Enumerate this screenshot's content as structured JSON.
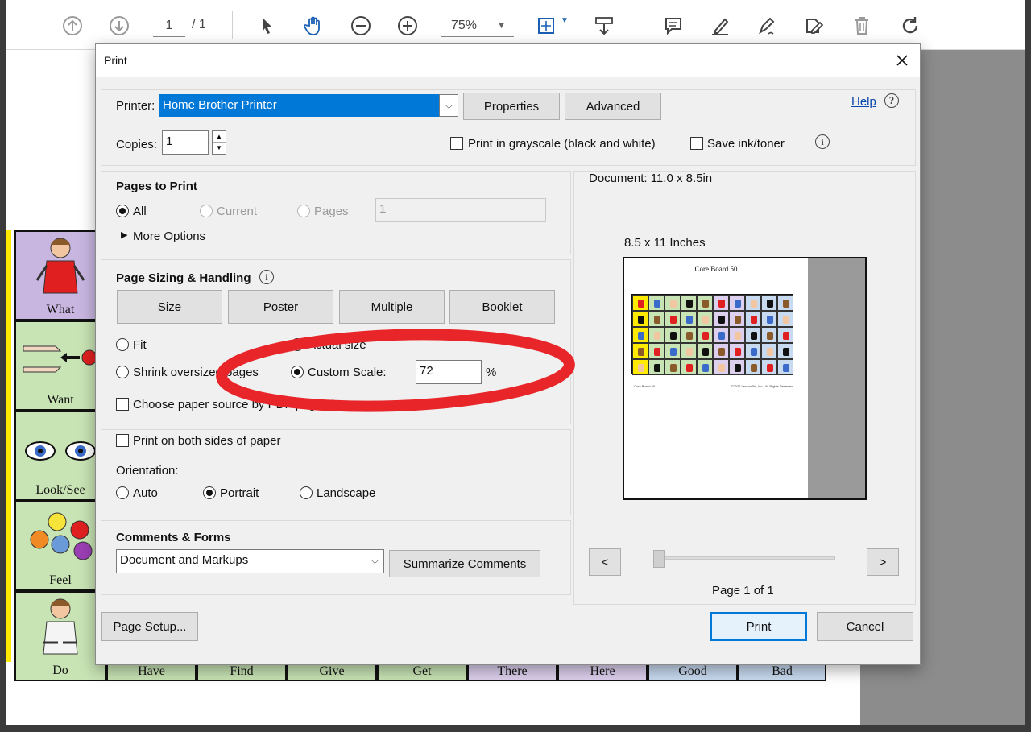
{
  "toolbar": {
    "page_current": "1",
    "page_total": "/ 1",
    "zoom": "75%"
  },
  "board": {
    "left_labels": [
      "What",
      "Want",
      "Look/See",
      "Feel",
      "Do"
    ],
    "bottom_labels": [
      "Have",
      "Find",
      "Give",
      "Get",
      "There",
      "Here",
      "Good",
      "Bad"
    ],
    "colors": {
      "what": "#c8b6e0",
      "green": "#c8e3b4",
      "purple": "#ddd0ee",
      "blue": "#c8daf0",
      "stripe": "#ffea00"
    }
  },
  "dialog": {
    "title": "Print",
    "printer_label": "Printer:",
    "printer_value": "Home Brother Printer",
    "properties_button": "Properties",
    "advanced_button": "Advanced",
    "help_link": "Help",
    "copies_label": "Copies:",
    "copies_value": "1",
    "grayscale_label": "Print in grayscale (black and white)",
    "save_ink_label": "Save ink/toner",
    "pages_to_print": {
      "heading": "Pages to Print",
      "all": "All",
      "current": "Current",
      "pages": "Pages",
      "pages_value": "1",
      "more_options": "More Options"
    },
    "sizing": {
      "heading": "Page Sizing & Handling",
      "size_button": "Size",
      "poster_button": "Poster",
      "multiple_button": "Multiple",
      "booklet_button": "Booklet",
      "fit": "Fit",
      "actual_size": "Actual size",
      "shrink": "Shrink oversized pages",
      "custom_scale": "Custom Scale:",
      "custom_scale_value": "72",
      "percent": "%",
      "paper_source": "Choose paper source by PDF page size"
    },
    "duplex_label": "Print on both sides of paper",
    "orientation": {
      "heading": "Orientation:",
      "auto": "Auto",
      "portrait": "Portrait",
      "landscape": "Landscape"
    },
    "comments": {
      "heading": "Comments & Forms",
      "value": "Document and Markups",
      "summarize_button": "Summarize Comments"
    },
    "preview": {
      "document_size": "Document: 11.0 x 8.5in",
      "paper_size": "8.5 x 11 Inches",
      "thumb_title": "Core Board 50",
      "thumb_footer_left": "Core Board 50",
      "thumb_footer_right": "©2022 LessonPix, Inc • All Rights Reserved",
      "prev_button": "<",
      "next_button": ">",
      "page_indicator": "Page 1 of 1"
    },
    "page_setup_button": "Page Setup...",
    "print_button": "Print",
    "cancel_button": "Cancel",
    "annotation_color": "#e8262a"
  }
}
